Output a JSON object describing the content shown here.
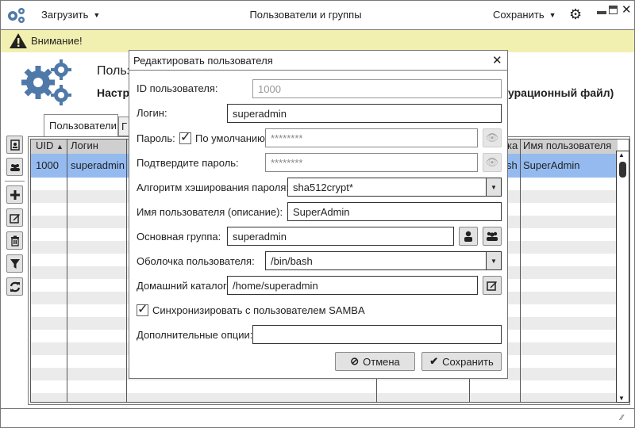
{
  "topbar": {
    "load_label": "Загрузить",
    "title": "Пользователи и группы",
    "save_label": "Сохранить"
  },
  "warning": {
    "text": "Внимание!"
  },
  "header": {
    "title_fragment": "Польз",
    "subtitle_fragment": "Настр",
    "subtitle_tail": "урационный файл)"
  },
  "tabs": [
    {
      "label": "Пользователи"
    },
    {
      "label": "Г"
    }
  ],
  "table": {
    "columns": [
      "UID",
      "Логин",
      "",
      "ка",
      "",
      "Имя пользователя"
    ],
    "rows": [
      {
        "uid": "1000",
        "login": "superadmin",
        "shell_tail": "sh",
        "name": "SuperAdmin"
      }
    ]
  },
  "dialog": {
    "title": "Редактировать пользователя",
    "id_label": "ID пользователя:",
    "id_value": "1000",
    "login_label": "Логин:",
    "login_value": "superadmin",
    "password_label": "Пароль:",
    "default_label": "По умолчанию",
    "password_value": "********",
    "confirm_label": "Подтвердите пароль:",
    "confirm_value": "********",
    "hash_label": "Алгоритм хэширования пароля:",
    "hash_value": "sha512crypt*",
    "name_label": "Имя пользователя (описание):",
    "name_value": "SuperAdmin",
    "group_label": "Основная группа:",
    "group_value": "superadmin",
    "shell_label": "Оболочка пользователя:",
    "shell_value": "/bin/bash",
    "home_label": "Домашний каталог:",
    "home_value": "/home/superadmin",
    "samba_label": "Синхронизировать с пользователем SAMBA",
    "options_label": "Дополнительные опции:",
    "options_value": "",
    "cancel_label": "Отмена",
    "save_label": "Сохранить"
  },
  "colors": {
    "warning_bg": "#f2f0b0",
    "selected_row": "#94baf0",
    "icon_blue": "#4f79a8"
  }
}
